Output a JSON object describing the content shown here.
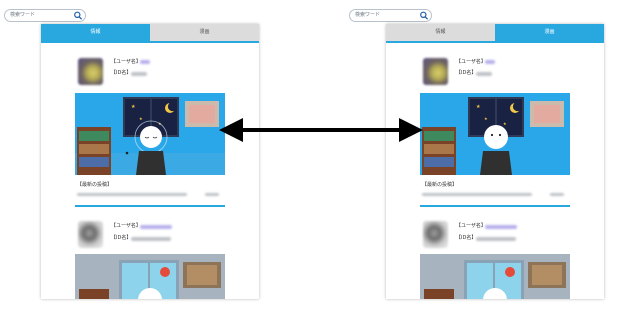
{
  "search": {
    "placeholder": "検索ワード"
  },
  "left_panel": {
    "tabs": [
      {
        "label": "情報",
        "active": true
      },
      {
        "label": "漫画",
        "active": false
      }
    ],
    "card1": {
      "user_label": "【ユーザ名】",
      "id_label": "【ID名】",
      "latest_post_label": "【最新の投稿】"
    },
    "card2": {
      "user_label": "【ユーザ名】",
      "id_label": "【ID名】"
    }
  },
  "right_panel": {
    "tabs": [
      {
        "label": "情報",
        "active": false
      },
      {
        "label": "漫画",
        "active": true
      }
    ],
    "card1": {
      "user_label": "【ユーザ名】",
      "id_label": "【ID名】",
      "latest_post_label": "【最新の投稿】"
    },
    "card2": {
      "user_label": "【ユーザ名】",
      "id_label": "【ID名】"
    }
  },
  "colors": {
    "accent": "#29a8e0",
    "inactive_tab": "#dcdcdc",
    "arrow": "#000000"
  }
}
